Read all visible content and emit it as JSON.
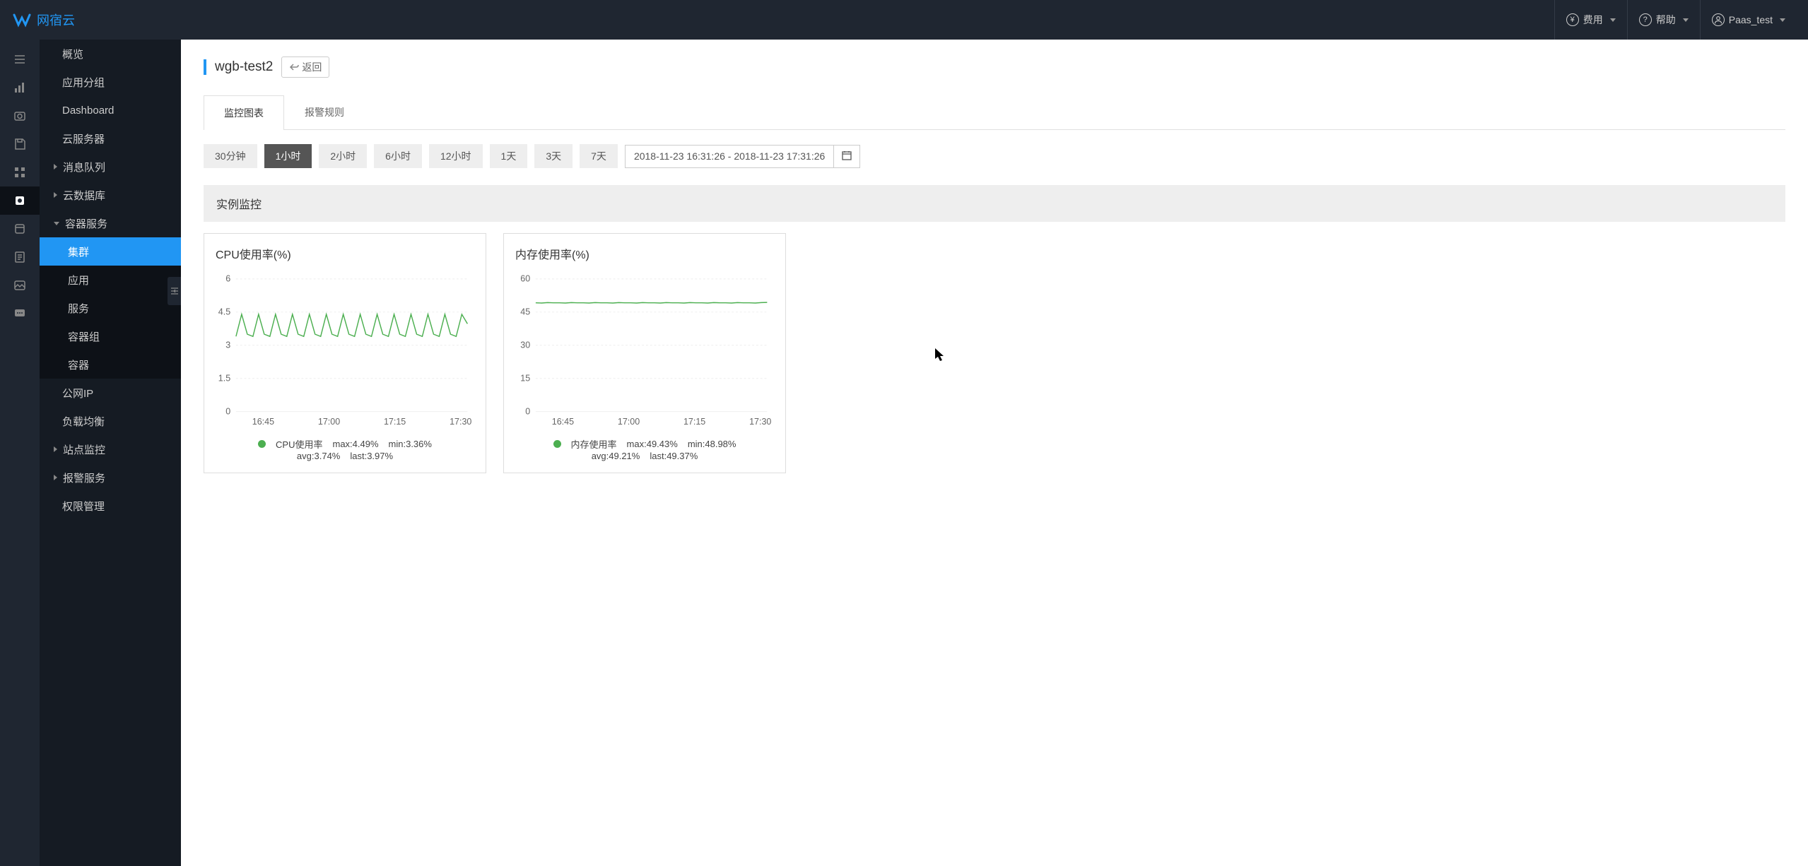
{
  "brand": {
    "name": "网宿云"
  },
  "header": {
    "billing": "费用",
    "help": "帮助",
    "user": "Paas_test"
  },
  "sidebar": {
    "items": {
      "overview": "概览",
      "app_group": "应用分组",
      "dashboard": "Dashboard",
      "cloud_server": "云服务器",
      "message_queue": "消息队列",
      "cloud_db": "云数据库",
      "container_service": "容器服务",
      "cluster": "集群",
      "application": "应用",
      "service": "服务",
      "pod": "容器组",
      "container": "容器",
      "public_ip": "公网IP",
      "load_balance": "负载均衡",
      "site_monitor": "站点监控",
      "alarm_service": "报警服务",
      "permission": "权限管理"
    }
  },
  "page": {
    "title": "wgb-test2",
    "back": "返回"
  },
  "tabs": {
    "charts": "监控图表",
    "rules": "报警规则"
  },
  "time": {
    "t30m": "30分钟",
    "t1h": "1小时",
    "t2h": "2小时",
    "t6h": "6小时",
    "t12h": "12小时",
    "t1d": "1天",
    "t3d": "3天",
    "t7d": "7天",
    "range": "2018-11-23 16:31:26 - 2018-11-23 17:31:26"
  },
  "section": {
    "instance_monitor": "实例监控"
  },
  "cpu": {
    "title": "CPU使用率(%)",
    "legend": "CPU使用率",
    "max": "max:4.49%",
    "min": "min:3.36%",
    "avg": "avg:3.74%",
    "last": "last:3.97%"
  },
  "mem": {
    "title": "内存使用率(%)",
    "legend": "内存使用率",
    "max": "max:49.43%",
    "min": "min:48.98%",
    "avg": "avg:49.21%",
    "last": "last:49.37%"
  },
  "chart_data": [
    {
      "type": "line",
      "title": "CPU使用率(%)",
      "xlabel": "",
      "ylabel": "",
      "ylim": [
        0,
        6
      ],
      "x_ticks": [
        "16:45",
        "17:00",
        "17:15",
        "17:30"
      ],
      "series": [
        {
          "name": "CPU使用率",
          "values": [
            3.4,
            4.4,
            3.5,
            3.4,
            4.4,
            3.5,
            3.4,
            4.4,
            3.5,
            3.4,
            4.4,
            3.5,
            3.4,
            4.4,
            3.5,
            3.4,
            4.4,
            3.5,
            3.4,
            4.4,
            3.5,
            3.4,
            4.4,
            3.5,
            3.4,
            4.4,
            3.5,
            3.4,
            4.4,
            3.5,
            3.4,
            4.4,
            3.5,
            3.4,
            4.4,
            3.5,
            3.4,
            4.4,
            3.5,
            3.4,
            4.4,
            3.97
          ],
          "stats": {
            "max": 4.49,
            "min": 3.36,
            "avg": 3.74,
            "last": 3.97
          }
        }
      ]
    },
    {
      "type": "line",
      "title": "内存使用率(%)",
      "xlabel": "",
      "ylabel": "",
      "ylim": [
        0,
        60
      ],
      "x_ticks": [
        "16:45",
        "17:00",
        "17:15",
        "17:30"
      ],
      "series": [
        {
          "name": "内存使用率",
          "values": [
            49.2,
            49.1,
            49.3,
            49.2,
            49.2,
            49.1,
            49.3,
            49.2,
            49.2,
            49.1,
            49.3,
            49.2,
            49.2,
            49.1,
            49.3,
            49.2,
            49.2,
            49.1,
            49.3,
            49.2,
            49.2,
            49.1,
            49.3,
            49.2,
            49.2,
            49.1,
            49.3,
            49.2,
            49.2,
            49.1,
            49.3,
            49.2,
            49.2,
            49.1,
            49.3,
            49.2,
            49.2,
            49.1,
            49.3,
            49.37
          ],
          "stats": {
            "max": 49.43,
            "min": 48.98,
            "avg": 49.21,
            "last": 49.37
          }
        }
      ]
    }
  ]
}
